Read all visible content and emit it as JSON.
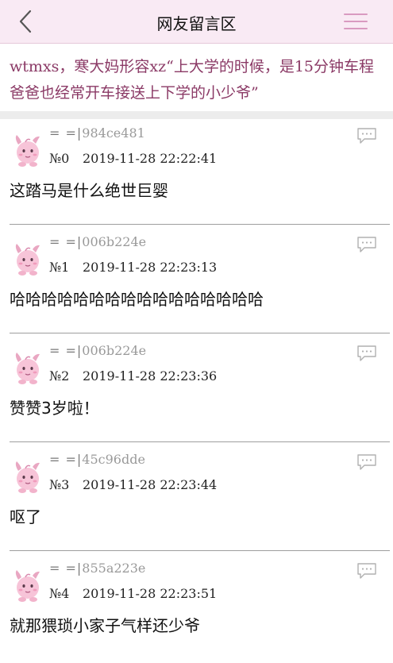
{
  "header": {
    "title": "网友留言区",
    "back_icon": "chevron-left-icon",
    "menu_icon": "hamburger-menu-icon"
  },
  "headline": "wtmxs，寒大妈形容xz“上大学的时候，是15分钟车程爸爸也经常开车接送上下学的小少爷”",
  "colors": {
    "header_bg": "#f9eaf4",
    "headline_text": "#8b3a66",
    "menu_lines": "#d99ac0"
  },
  "comments": [
    {
      "user_prefix": "= =|",
      "user_id": "984ce481",
      "floor": "№0",
      "time": "2019-11-28 22:22:41",
      "text": "这踏马是什么绝世巨婴"
    },
    {
      "user_prefix": "= =|",
      "user_id": "006b224e",
      "floor": "№1",
      "time": "2019-11-28 22:23:13",
      "text": "哈哈哈哈哈哈哈哈哈哈哈哈哈哈哈哈"
    },
    {
      "user_prefix": "= =|",
      "user_id": "006b224e",
      "floor": "№2",
      "time": "2019-11-28 22:23:36",
      "text": "赞赞3岁啦！"
    },
    {
      "user_prefix": "= =|",
      "user_id": "45c96dde",
      "floor": "№3",
      "time": "2019-11-28 22:23:44",
      "text": "呕了"
    },
    {
      "user_prefix": "= =|",
      "user_id": "855a223e",
      "floor": "№4",
      "time": "2019-11-28 22:23:51",
      "text": "就那猥琐小家子气样还少爷"
    }
  ]
}
